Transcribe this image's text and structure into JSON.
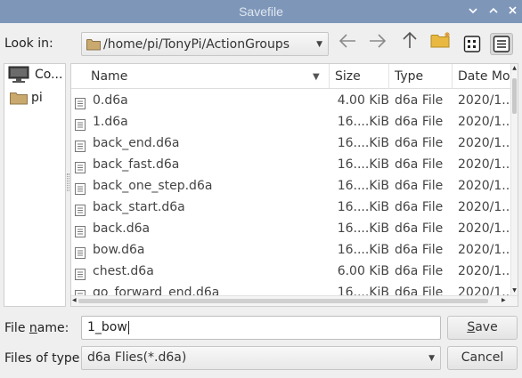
{
  "window": {
    "title": "Savefile",
    "controls": [
      "chevron-down-icon",
      "chevron-up-icon",
      "close-icon"
    ]
  },
  "toolbar": {
    "look_in_label": "Look in:",
    "current_path": "/home/pi/TonyPi/ActionGroups"
  },
  "sidebar": {
    "items": [
      {
        "label": "Co...",
        "icon": "computer-icon"
      },
      {
        "label": "pi",
        "icon": "folder-icon"
      }
    ]
  },
  "file_list": {
    "columns": [
      "Name",
      "Size",
      "Type",
      "Date Mo"
    ],
    "rows": [
      {
        "name": "0.d6a",
        "size": "4.00 KiB",
        "type": "d6a File",
        "date": "2020/1.."
      },
      {
        "name": "1.d6a",
        "size": "16....KiB",
        "type": "d6a File",
        "date": "2020/1.."
      },
      {
        "name": "back_end.d6a",
        "size": "16....KiB",
        "type": "d6a File",
        "date": "2020/1.."
      },
      {
        "name": "back_fast.d6a",
        "size": "16....KiB",
        "type": "d6a File",
        "date": "2020/1.."
      },
      {
        "name": "back_one_step.d6a",
        "size": "16....KiB",
        "type": "d6a File",
        "date": "2020/1.."
      },
      {
        "name": "back_start.d6a",
        "size": "16....KiB",
        "type": "d6a File",
        "date": "2020/1.."
      },
      {
        "name": "back.d6a",
        "size": "16....KiB",
        "type": "d6a File",
        "date": "2020/1.."
      },
      {
        "name": "bow.d6a",
        "size": "16....KiB",
        "type": "d6a File",
        "date": "2020/1.."
      },
      {
        "name": "chest.d6a",
        "size": "6.00 KiB",
        "type": "d6a File",
        "date": "2020/1.."
      },
      {
        "name": "go_forward_end.d6a",
        "size": "16....KiB",
        "type": "d6a File",
        "date": "2020/1.."
      }
    ]
  },
  "form": {
    "file_name_label_pre": "File ",
    "file_name_label_mnemonic": "n",
    "file_name_label_post": "ame:",
    "file_name_value": "1_bow",
    "file_type_label": "Files of type:",
    "file_type_value": "d6a Flies(*.d6a)",
    "save_label_mnemonic": "S",
    "save_label_rest": "ave",
    "cancel_label": "Cancel"
  },
  "colors": {
    "titlebar": "#7e97b9",
    "folder": "#c9a96e",
    "new_folder": "#e8b840"
  }
}
